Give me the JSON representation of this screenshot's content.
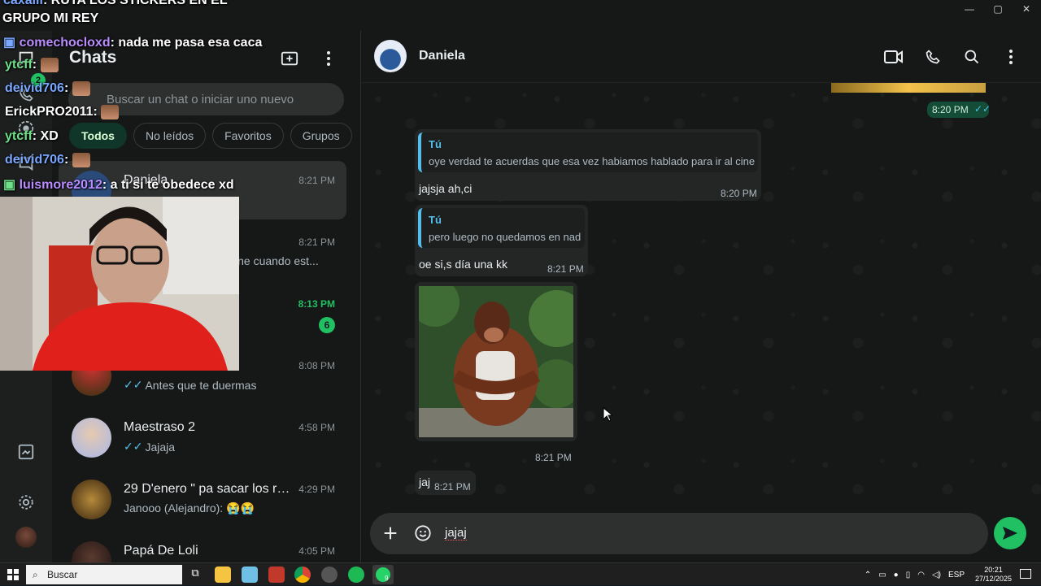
{
  "window": {
    "minimize": "—",
    "maximize": "▢",
    "close": "✕"
  },
  "rail": {
    "chats_badge": "2"
  },
  "chat_list": {
    "title": "Chats",
    "search_placeholder": "Buscar un chat o iniciar uno nuevo",
    "filters": [
      "Todos",
      "No leídos",
      "Favoritos",
      "Grupos"
    ],
    "items": [
      {
        "name": "Daniela",
        "time": "8:21 PM",
        "preview": "",
        "selected": true
      },
      {
        "name": "",
        "time": "8:21 PM",
        "preview": "cine cuando est..."
      },
      {
        "name": "",
        "time": "8:13 PM",
        "preview": "",
        "unread": "6"
      },
      {
        "name": "",
        "time": "8:08 PM",
        "preview": "Antes que te duermas"
      },
      {
        "name": "Maestraso 2",
        "time": "4:58 PM",
        "preview": "Jajaja"
      },
      {
        "name": "29 D'enero \" pa sacar los ret...",
        "time": "4:29 PM",
        "preview": "Janooo (Alejandro): 😭😭"
      },
      {
        "name": "Papá De Loli",
        "time": "4:05 PM",
        "preview": ""
      }
    ]
  },
  "conversation": {
    "contact": "Daniela",
    "top_time": "8:20 PM",
    "messages": [
      {
        "quote_author": "Tú",
        "quote_text": "oye verdad te acuerdas que esa vez habiamos hablado para ir al cine",
        "text": "jajsja ah,ci",
        "time": "8:20 PM"
      },
      {
        "quote_author": "Tú",
        "quote_text": "pero luego no quedamos en nad",
        "text": "oe si,s día una kk",
        "time": "8:21 PM"
      },
      {
        "image_time": "8:21 PM"
      },
      {
        "text": "jaj",
        "time": "8:21 PM"
      }
    ],
    "composer_text": "jajaj"
  },
  "stream_overlay": [
    {
      "user": "caxalii",
      "msg": ": RUTA LOS STICKERS EN EL"
    },
    {
      "user": "",
      "msg": "GRUPO MI REY"
    },
    {
      "user": "comechocloxd",
      "msg": ": nada me pasa esa caca"
    },
    {
      "user": "ytcff",
      "msg": ":"
    },
    {
      "user": "deivid706",
      "msg": ":"
    },
    {
      "user": "ErickPRO2011",
      "msg": ":"
    },
    {
      "user": "ytcff",
      "msg": ": XD"
    },
    {
      "user": "deivid706",
      "msg": ":"
    },
    {
      "user": "luismore2012",
      "msg": ": a ti si te obedece xd"
    }
  ],
  "taskbar": {
    "search": "Buscar",
    "lang": "ESP",
    "time": "20:21",
    "date": "27/12/2025",
    "whatsapp_badge": "9"
  },
  "colors": {
    "accent": "#21c063",
    "outgoing": "#144d37",
    "incoming": "#242626",
    "quote": "#53bdeb"
  }
}
